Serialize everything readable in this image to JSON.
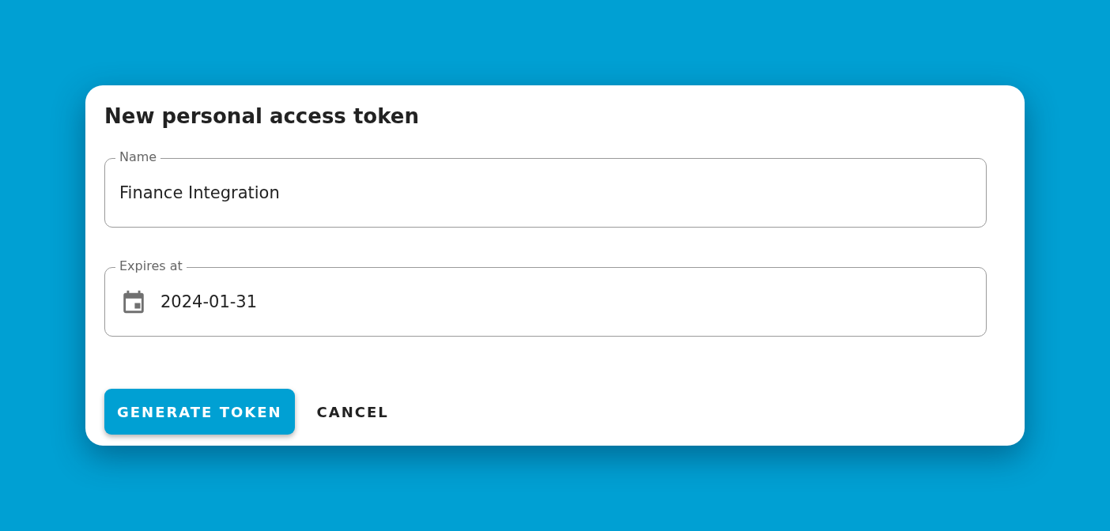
{
  "dialog": {
    "title": "New personal access token",
    "fields": [
      {
        "kind": "text",
        "label": "Name",
        "value": "Finance Integration"
      },
      {
        "kind": "date",
        "label": "Expires at",
        "value": "2024-01-31"
      }
    ],
    "buttons": [
      {
        "kind": "primary",
        "label": "GENERATE TOKEN"
      },
      {
        "kind": "text",
        "label": "CANCEL"
      }
    ]
  }
}
